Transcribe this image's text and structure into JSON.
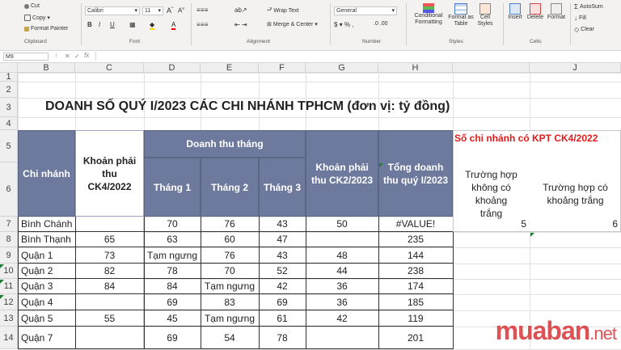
{
  "ribbon": {
    "clipboard": {
      "cut": "Cut",
      "copy": "Copy",
      "format_painter": "Format Painter",
      "group": "Clipboard"
    },
    "font": {
      "name": "Calibri",
      "size": "11",
      "group": "Font"
    },
    "alignment": {
      "wrap": "Wrap Text",
      "merge": "Merge & Center",
      "group": "Alignment"
    },
    "number": {
      "format": "General",
      "group": "Number"
    },
    "styles": {
      "conditional": "Conditional Formatting",
      "format_table": "Format as Table",
      "cell_styles": "Cell Styles",
      "group": "Styles"
    },
    "cells": {
      "insert": "Insert",
      "delete": "Delete",
      "format": "Format",
      "group": "Cells"
    },
    "editing": {
      "autosum": "AutoSum",
      "fill": "Fill",
      "clear": "Clear"
    }
  },
  "name_box": "M9",
  "columns": [
    "B",
    "C",
    "D",
    "E",
    "F",
    "G",
    "H",
    "",
    "J",
    "K"
  ],
  "rows": [
    "1",
    "2",
    "3",
    "4",
    "5",
    "6",
    "7",
    "8",
    "9",
    "10",
    "11",
    "12",
    "13",
    "14"
  ],
  "title": "DOANH SỐ QUÝ I/2023 CÁC CHI NHÁNH TPHCM (đơn vị: tỷ đồng)",
  "table": {
    "h_branch": "Chi nhánh",
    "h_receivable_ck4": "Khoản phải thu CK4/2022",
    "h_monthly": "Doanh thu tháng",
    "h_m1": "Tháng 1",
    "h_m2": "Tháng 2",
    "h_m3": "Tháng 3",
    "h_receivable_ck2": "Khoản phải thu CK2/2023",
    "h_total": "Tổng doanh thu quý I/2023",
    "rows": [
      {
        "branch": "Bình Chánh",
        "ck4": "",
        "m1": "70",
        "m2": "76",
        "m3": "43",
        "ck2": "50",
        "total": "#VALUE!"
      },
      {
        "branch": "Bình Thạnh",
        "ck4": "65",
        "m1": "63",
        "m2": "60",
        "m3": "47",
        "ck2": "",
        "total": "235"
      },
      {
        "branch": "Quận 1",
        "ck4": "73",
        "m1": "Tạm ngưng",
        "m2": "76",
        "m3": "43",
        "ck2": "48",
        "total": "144"
      },
      {
        "branch": "Quận 2",
        "ck4": "82",
        "m1": "78",
        "m2": "70",
        "m3": "52",
        "ck2": "44",
        "total": "238"
      },
      {
        "branch": "Quận 3",
        "ck4": "84",
        "m1": "84",
        "m2": "Tạm ngưng",
        "m3": "42",
        "ck2": "36",
        "total": "174"
      },
      {
        "branch": "Quận 4",
        "ck4": "",
        "m1": "69",
        "m2": "83",
        "m3": "69",
        "ck2": "36",
        "total": "185"
      },
      {
        "branch": "Quận 5",
        "ck4": "55",
        "m1": "45",
        "m2": "Tạm ngưng",
        "m3": "61",
        "ck2": "42",
        "total": "119"
      },
      {
        "branch": "Quận 7",
        "ck4": "",
        "m1": "69",
        "m2": "54",
        "m3": "78",
        "ck2": "",
        "total": "201"
      }
    ]
  },
  "side": {
    "title": "Số chi nhánh có KPT CK4/2022",
    "col_a": "Trường hợp không có khoảng trắng",
    "col_b": "Trường hợp có khoảng trắng",
    "val_a": "5",
    "val_b": "6"
  },
  "watermark": {
    "brand": "muaban",
    "tld": ".net"
  },
  "colors": {
    "header_fill": "#6d7a9e",
    "title_red": "#e31b1b",
    "watermark_red": "#d7262b"
  }
}
